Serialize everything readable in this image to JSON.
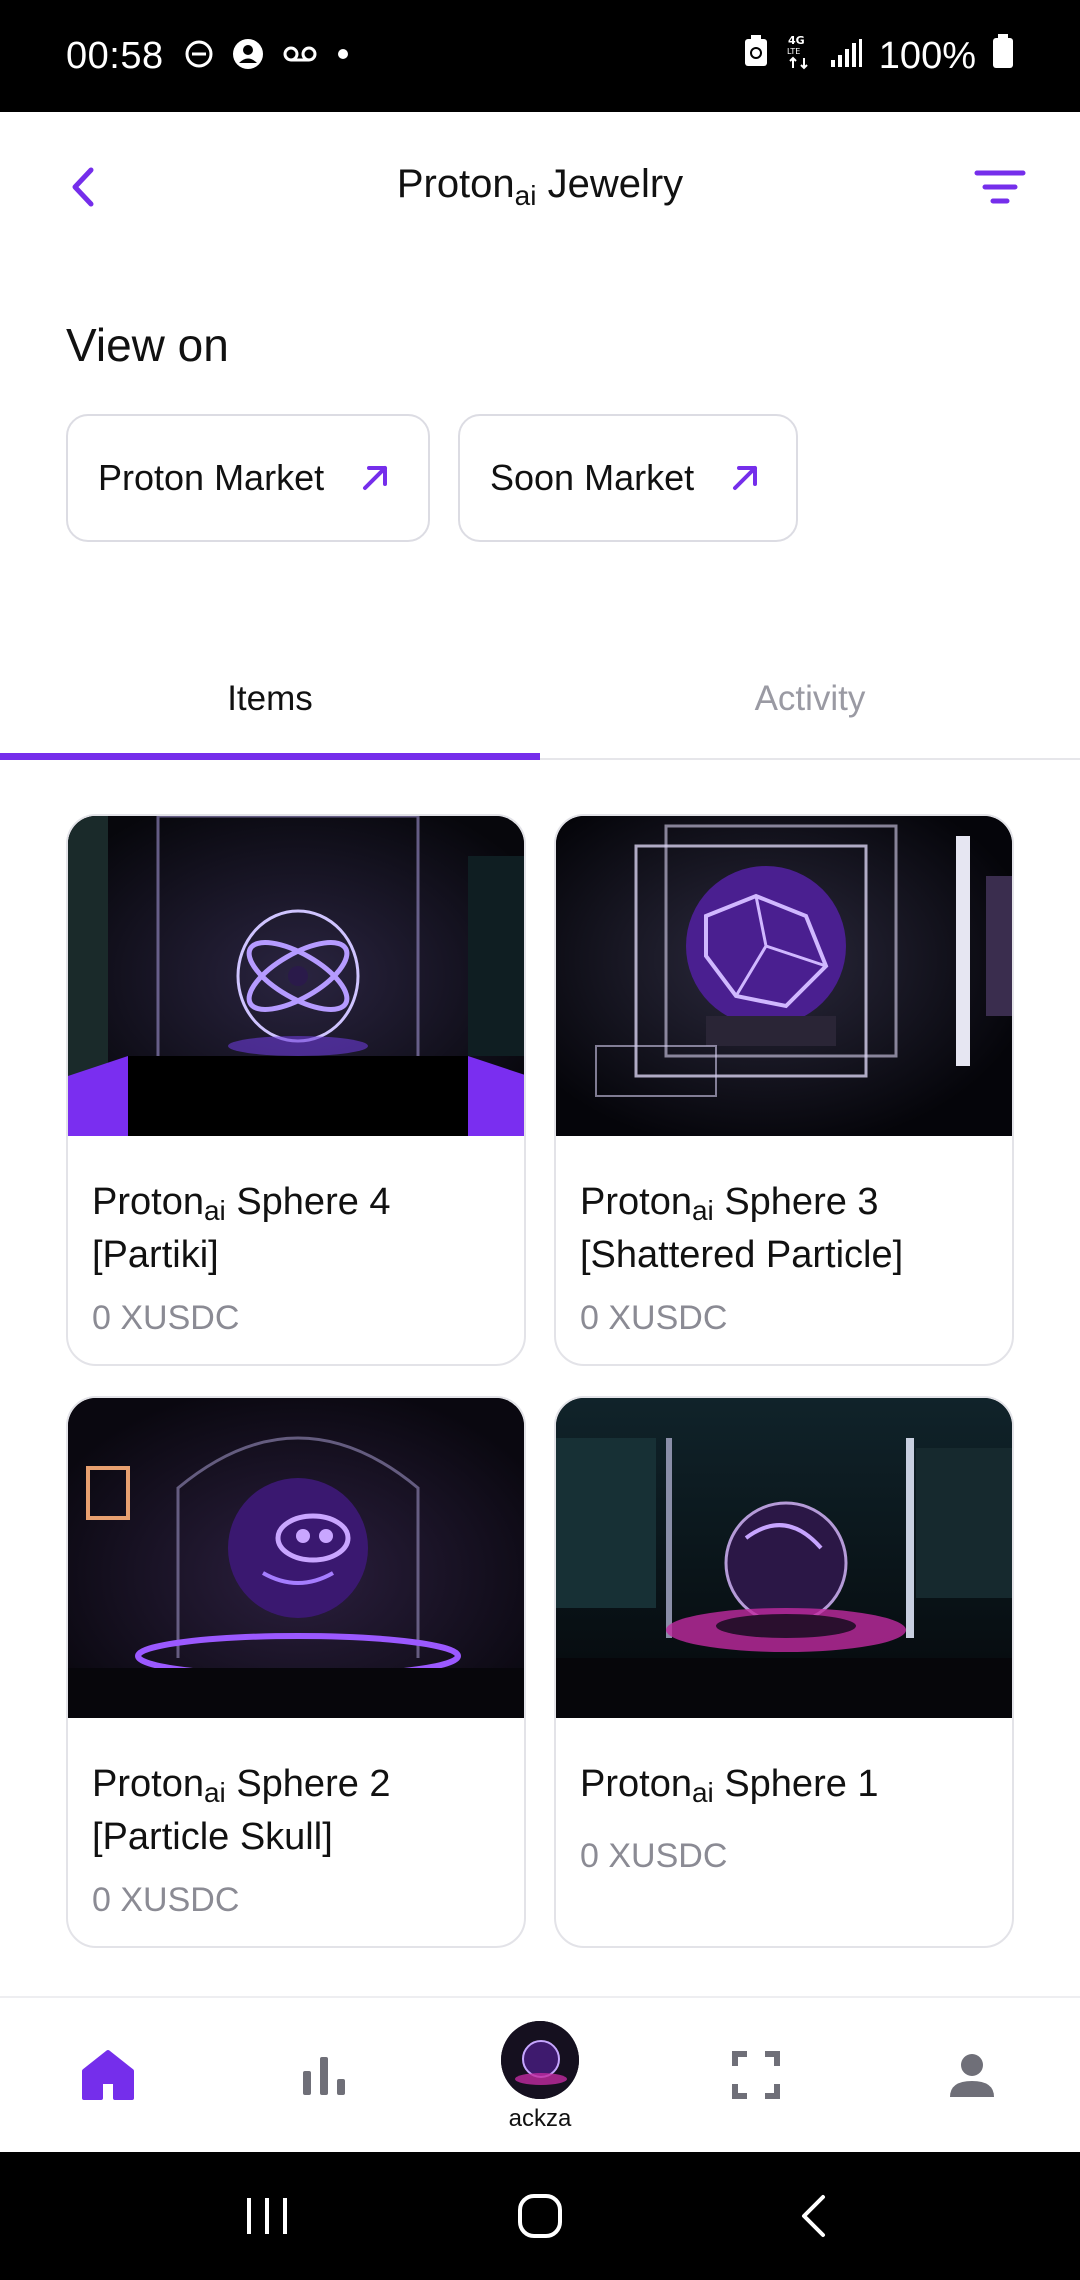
{
  "status_bar": {
    "time": "00:58",
    "battery": "100%",
    "icons": [
      "dnd-icon",
      "account-circle-icon",
      "voicemail-icon",
      "dot-icon",
      "battery-saver-icon",
      "4g-lte-icon",
      "signal-icon",
      "battery-icon"
    ]
  },
  "header": {
    "title_main": "Proton",
    "title_sub": "ai",
    "title_rest": " Jewelry",
    "back_icon": "chevron-left-icon",
    "filter_icon": "filter-icon"
  },
  "view_on": {
    "label": "View on",
    "markets": [
      {
        "label": "Proton Market",
        "icon": "arrow-up-right-icon"
      },
      {
        "label": "Soon Market",
        "icon": "arrow-up-right-icon"
      }
    ]
  },
  "tabs": [
    {
      "label": "Items",
      "active": true
    },
    {
      "label": "Activity",
      "active": false
    }
  ],
  "items": [
    {
      "title_main": "Proton",
      "title_sub": "ai",
      "title_rest": " Sphere 4 [Partiki]",
      "price": "0 XUSDC"
    },
    {
      "title_main": "Proton",
      "title_sub": "ai",
      "title_rest": " Sphere 3 [Shattered Particle]",
      "price": "0 XUSDC"
    },
    {
      "title_main": "Proton",
      "title_sub": "ai",
      "title_rest": " Sphere 2 [Particle Skull]",
      "price": "0 XUSDC"
    },
    {
      "title_main": "Proton",
      "title_sub": "ai",
      "title_rest": " Sphere 1",
      "price": "0 XUSDC"
    }
  ],
  "bottom_nav": {
    "items": [
      "home-icon",
      "bar-chart-icon",
      "avatar",
      "scan-icon",
      "person-icon"
    ],
    "avatar_label": "ackza"
  },
  "colors": {
    "accent": "#752eeb",
    "inactive": "#9a9aa3",
    "icon_gray": "#6f6f78"
  }
}
